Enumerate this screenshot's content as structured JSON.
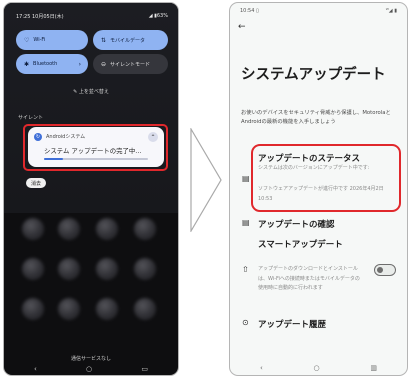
{
  "left_phone": {
    "status_time": "17:25 10月05日(木)",
    "status_battery": "◢ ▮63%",
    "tiles": [
      {
        "label": "Wi-Fi",
        "icon": "wifi-icon",
        "glyph": "♡",
        "state": "on"
      },
      {
        "label": "モバイルデータ",
        "icon": "mobile-data-icon",
        "glyph": "⇅",
        "state": "on"
      },
      {
        "label": "Bluetooth",
        "icon": "bluetooth-icon",
        "glyph": "✱",
        "state": "on",
        "chevron": "›"
      },
      {
        "label": "サイレントモード",
        "icon": "silent-mode-icon",
        "glyph": "⊖",
        "state": "off"
      }
    ],
    "edit_label": "✎ 上を並べ替え",
    "section_silent": "サイレント",
    "notification": {
      "app_icon_glyph": "↻",
      "app_name": "Androidシステム",
      "expand_glyph": "⌃",
      "message": "システム アップデートの完了中...",
      "progress": 0.18
    },
    "clear_label": "消去",
    "carrier": "通信サービスなし",
    "nav": {
      "back": "‹",
      "home": "○",
      "recents": "▭"
    }
  },
  "right_phone": {
    "status_time": "10:54 ▯",
    "status_icons": "ᵂ◢ ▮",
    "back_glyph": "←",
    "title": "システムアップデート",
    "description": "お使いのデバイスをセキュリティ脅威から保護し、MotorolaとAndroidの最新の機能を入手しましょう",
    "update_status": {
      "icon_glyph": "▤",
      "label": "アップデートのステータス",
      "line1": "システムは次のバージョンにアップデート中です:",
      "line2": "ソフトウェアアップデートが進行中です 2026年4月2日10:53"
    },
    "check_update": {
      "icon_glyph": "▤",
      "label": "アップデートの確認"
    },
    "smart_update": {
      "icon_glyph": "⇧",
      "label": "スマートアップデート",
      "sub": "アップデートのダウンロードとインストールは、Wi-Fiへの接続時またはモバイルデータの使用時に自動的に行われます",
      "enabled": false
    },
    "history": {
      "icon_glyph": "⊙",
      "label": "アップデート履歴"
    },
    "nav": {
      "back": "‹",
      "home": "○",
      "recents": "▥"
    }
  },
  "colors": {
    "highlight": "#e0282c",
    "tile_on": "#8fb3f2",
    "accent": "#3f6fd8"
  }
}
